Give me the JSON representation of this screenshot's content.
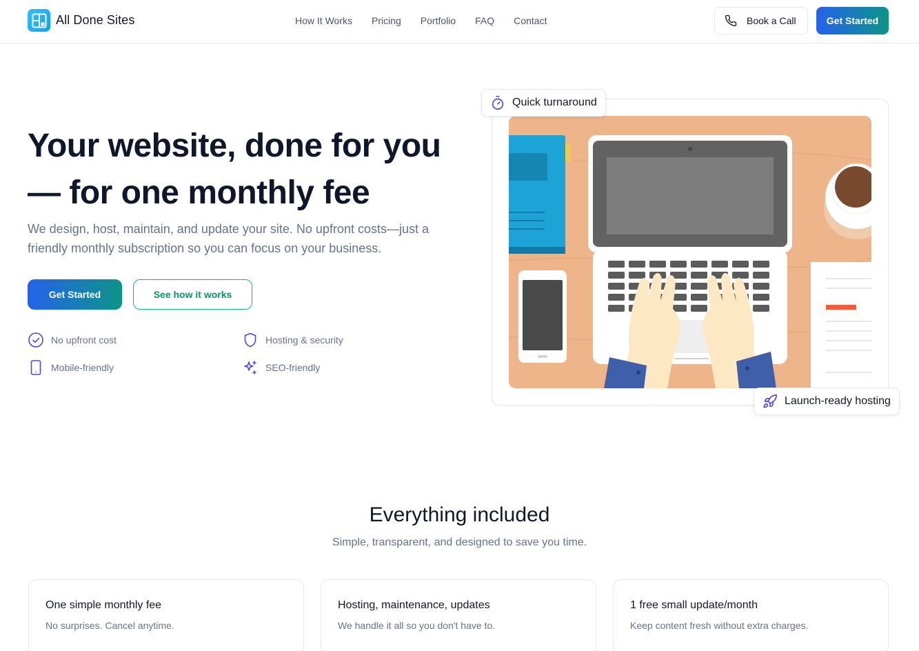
{
  "header": {
    "brand": "All Done Sites",
    "nav": [
      "How It Works",
      "Pricing",
      "Portfolio",
      "FAQ",
      "Contact"
    ],
    "book_call": "Book a Call",
    "get_started": "Get Started"
  },
  "hero": {
    "title_line1": "Your website, done for you",
    "title_line2": "— for one monthly fee",
    "subtitle": "We design, host, maintain, and update your site. No upfront costs—just a friendly monthly subscription so you can focus on your business.",
    "primary_cta": "Get Started",
    "secondary_cta": "See how it works",
    "features": [
      {
        "label": "No upfront cost",
        "icon": "check-circle-icon"
      },
      {
        "label": "Hosting & security",
        "icon": "shield-icon"
      },
      {
        "label": "Mobile-friendly",
        "icon": "smartphone-icon"
      },
      {
        "label": "SEO-friendly",
        "icon": "sparkles-icon"
      }
    ],
    "badges": {
      "top": "Quick turnaround",
      "bottom": "Launch-ready hosting"
    }
  },
  "included": {
    "title": "Everything included",
    "subtitle": "Simple, transparent, and designed to save you time.",
    "cards": [
      {
        "title": "One simple monthly fee",
        "text": "No surprises. Cancel anytime."
      },
      {
        "title": "Hosting, maintenance, updates",
        "text": "We handle it all so you don't have to."
      },
      {
        "title": "1 free small update/month",
        "text": "Keep content fresh without extra charges."
      }
    ]
  },
  "colors": {
    "accent_blue": "#2563eb",
    "accent_teal": "#0d9488",
    "accent_green": "#10b981",
    "text_dark": "#0f172a",
    "text_muted": "#64748b"
  }
}
